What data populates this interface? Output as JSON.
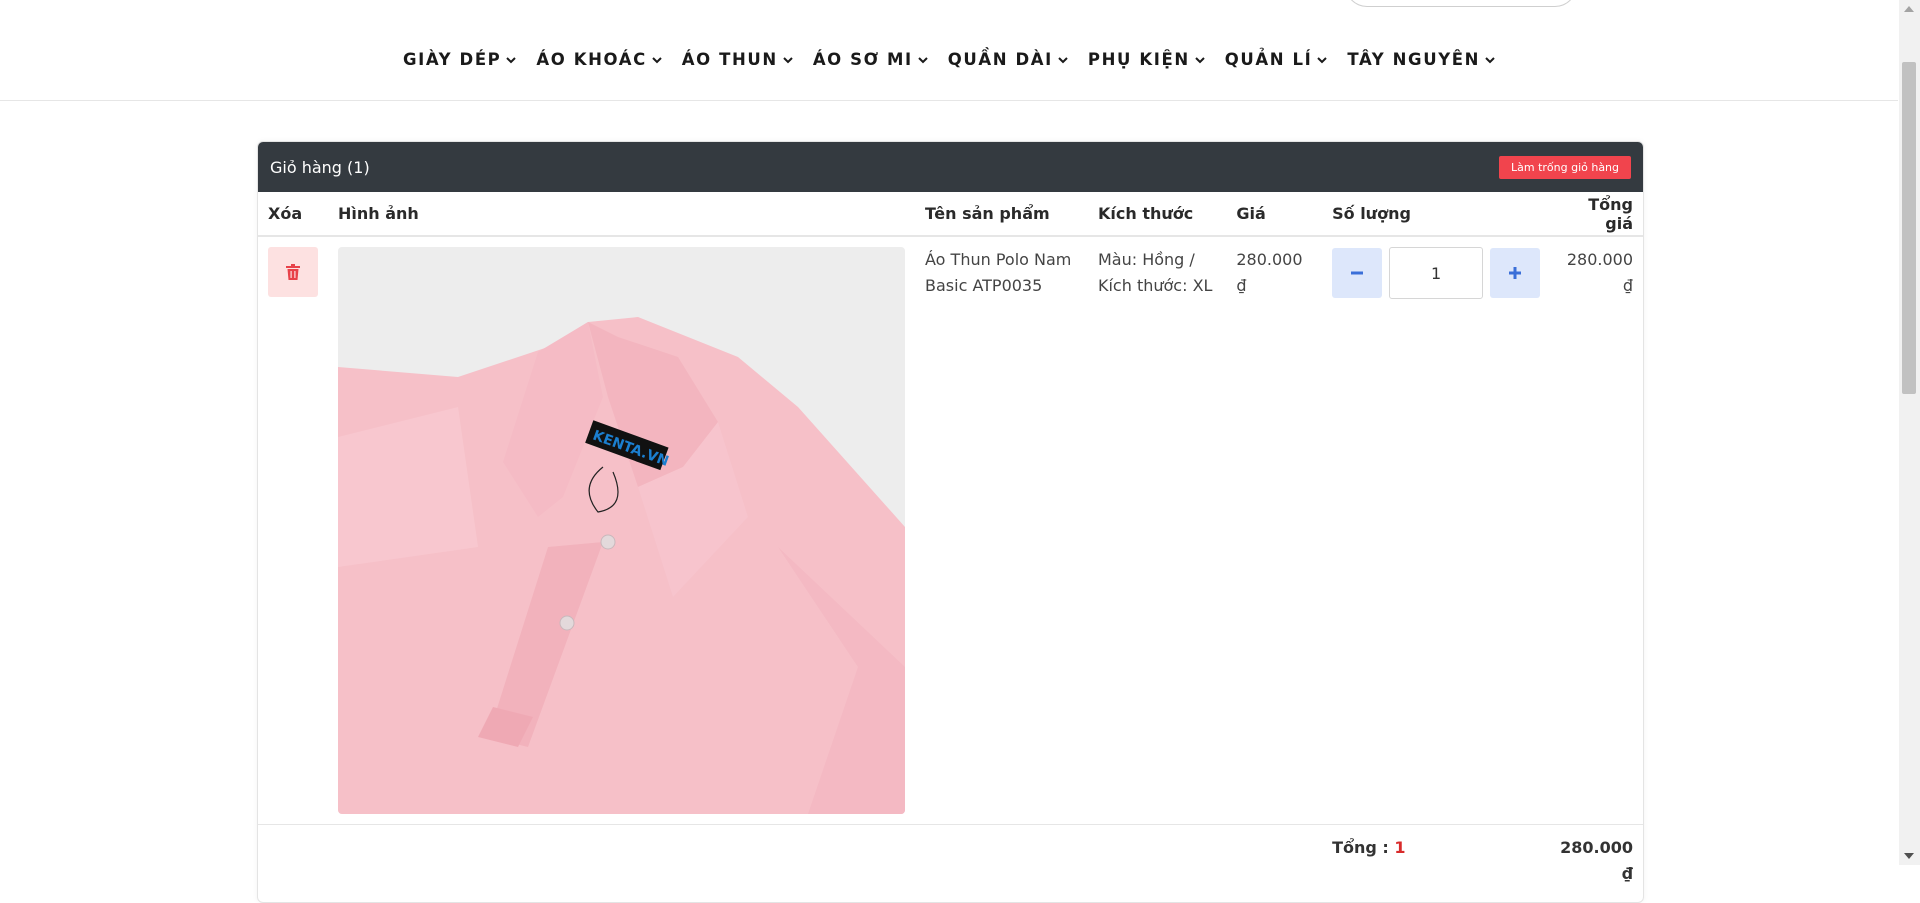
{
  "nav": {
    "items": [
      {
        "label": "GIÀY DÉP"
      },
      {
        "label": "ÁO KHOÁC"
      },
      {
        "label": "ÁO THUN"
      },
      {
        "label": "ÁO SƠ MI"
      },
      {
        "label": "QUẦN DÀI"
      },
      {
        "label": "PHỤ KIỆN"
      },
      {
        "label": "QUẢN LÍ"
      },
      {
        "label": "TÂY NGUYÊN"
      }
    ]
  },
  "cart": {
    "title": "Giỏ hàng (1)",
    "clear_label": "Làm trống giỏ hàng",
    "columns": {
      "delete": "Xóa",
      "image": "Hình ảnh",
      "name": "Tên sản phẩm",
      "size": "Kích thước",
      "price": "Giá",
      "quantity": "Số lượng",
      "total": "Tổng giá"
    },
    "items": [
      {
        "name": "Áo Thun Polo Nam Basic ATP0035",
        "variant": "Màu: Hồng / Kích thước: XL",
        "price": "280.000 ₫",
        "quantity": "1",
        "total": "280.000 ₫",
        "tag_text": "KENTA.VN"
      }
    ],
    "summary": {
      "label": "Tổng :",
      "count": "1",
      "amount": "280.000 ₫"
    }
  },
  "icons": {
    "delete": "trash-icon",
    "minus": "minus-icon",
    "plus": "plus-icon",
    "chevron": "chevron-down-icon"
  },
  "colors": {
    "header_bg": "#343a40",
    "danger": "#f1444d",
    "accent_blue": "#3a6fd8",
    "price_red": "#d82b2b"
  }
}
